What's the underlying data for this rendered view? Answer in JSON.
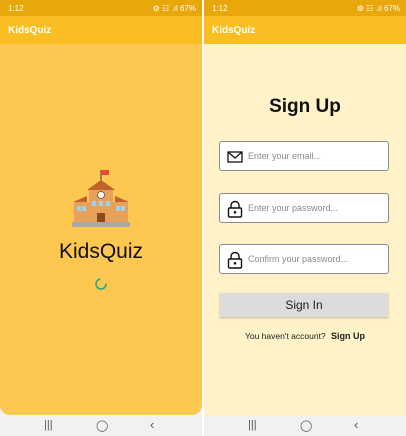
{
  "left_screen": {
    "status_time": "1:12",
    "status_icons": "⚙ ☷ .ıl 67%",
    "app_title": "KidsQuiz",
    "splash_title": "KidsQuiz",
    "nav": {
      "recent": "|||",
      "home": "◯",
      "back": "‹"
    }
  },
  "right_screen": {
    "status_time": "1:12",
    "status_icons": "⚙ ☷ .ıl 67%",
    "app_title": "KidsQuiz",
    "page_title": "Sign Up",
    "email_placeholder": "Enter your email...",
    "password_placeholder": "Enter your password...",
    "confirm_placeholder": "Confirm your password...",
    "signin_label": "Sign In",
    "no_account_text": "You haven't account?",
    "signup_link": "Sign Up",
    "nav": {
      "recent": "|||",
      "home": "◯",
      "back": "‹"
    }
  },
  "colors": {
    "status_bar": "#e8a70a",
    "app_bar": "#fbbe22",
    "splash_bg": "#fdc750",
    "form_bg": "#fff1c8",
    "spinner": "#2aa98b"
  }
}
